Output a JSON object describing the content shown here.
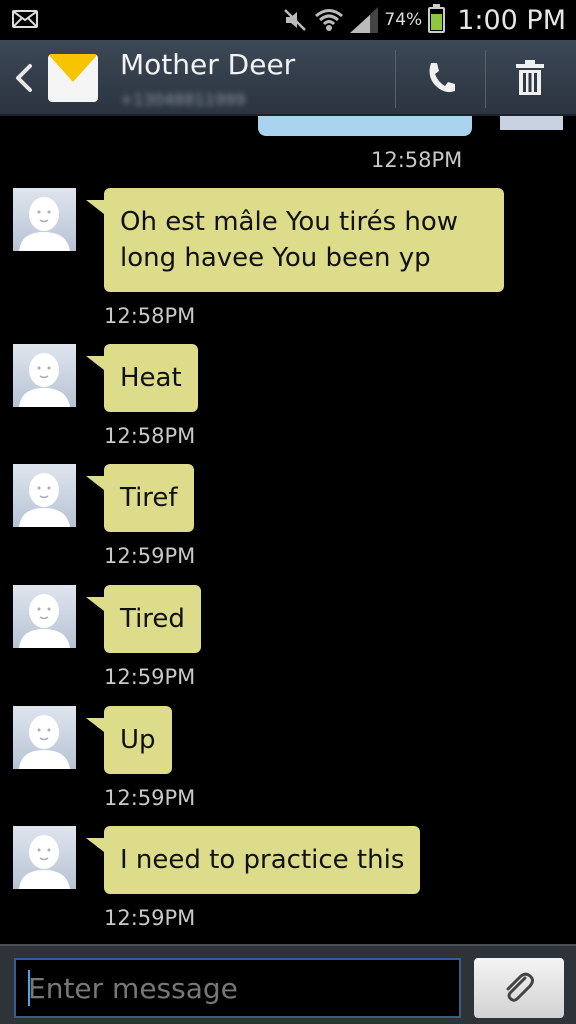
{
  "status_bar": {
    "battery_percent": "74%",
    "time": "1:00 PM",
    "battery_level": 0.74,
    "icons": [
      "message-notification-icon",
      "mute-icon",
      "wifi-icon",
      "signal-icon",
      "battery-icon"
    ]
  },
  "header": {
    "contact_name": "Mother Deer",
    "contact_number": "+13048811999",
    "icons": [
      "back-icon",
      "messaging-app-icon",
      "call-icon",
      "delete-icon"
    ]
  },
  "messages": [
    {
      "direction": "sent",
      "text": "",
      "time": "12:58PM"
    },
    {
      "direction": "received",
      "text": "Oh est mâle You tirés how\nlong havee You been yp",
      "time": "12:58PM"
    },
    {
      "direction": "received",
      "text": "Heat",
      "time": "12:58PM"
    },
    {
      "direction": "received",
      "text": "Tiref",
      "time": "12:59PM"
    },
    {
      "direction": "received",
      "text": "Tired",
      "time": "12:59PM"
    },
    {
      "direction": "received",
      "text": "Up",
      "time": "12:59PM"
    },
    {
      "direction": "received",
      "text": "I need to practice this",
      "time": "12:59PM"
    }
  ],
  "composer": {
    "placeholder": "Enter message",
    "value": "",
    "attach_icon": "paperclip-icon"
  },
  "colors": {
    "received_bubble": "#dcdc8a",
    "sent_bubble": "#a9d3ee",
    "header_bg": "#344050",
    "input_border": "#355e8e"
  }
}
